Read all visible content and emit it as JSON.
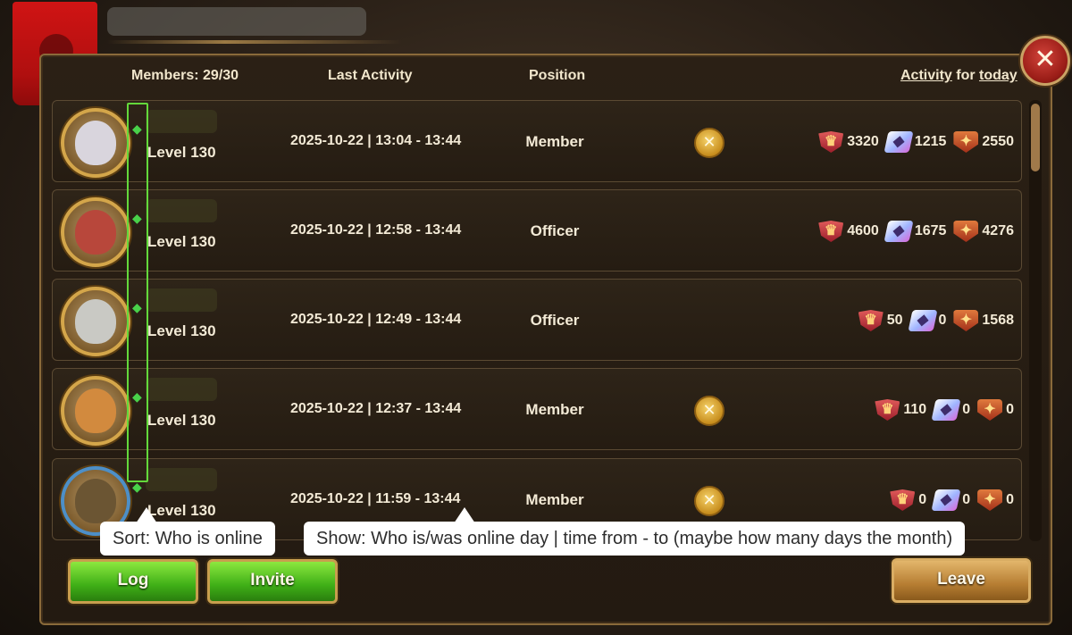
{
  "header": {
    "members_label": "Members:",
    "members_count": "29/30",
    "last_activity_label": "Last Activity",
    "position_label": "Position",
    "activity_word": "Activity",
    "for_word": "for",
    "period": "today"
  },
  "close_icon": "close-x-icon",
  "members": [
    {
      "level": "Level 130",
      "activity": "2025-10-22 | 13:04 - 13:44",
      "position": "Member",
      "kick": true,
      "stats": [
        "3320",
        "1215",
        "2550"
      ]
    },
    {
      "level": "Level 130",
      "activity": "2025-10-22 | 12:58 - 13:44",
      "position": "Officer",
      "kick": false,
      "stats": [
        "4600",
        "1675",
        "4276"
      ]
    },
    {
      "level": "Level 130",
      "activity": "2025-10-22 | 12:49 - 13:44",
      "position": "Officer",
      "kick": false,
      "stats": [
        "50",
        "0",
        "1568"
      ]
    },
    {
      "level": "Level 130",
      "activity": "2025-10-22 | 12:37 - 13:44",
      "position": "Member",
      "kick": true,
      "stats": [
        "110",
        "0",
        "0"
      ]
    },
    {
      "level": "Level 130",
      "activity": "2025-10-22 | 11:59 - 13:44",
      "position": "Member",
      "kick": true,
      "stats": [
        "0",
        "0",
        "0"
      ]
    }
  ],
  "callouts": {
    "sort": "Sort: Who is online",
    "show": "Show: Who is/was online day | time from - to  (maybe how many days the month)"
  },
  "buttons": {
    "log": "Log",
    "invite": "Invite",
    "leave": "Leave"
  },
  "colors": {
    "online_green": "#63d93b",
    "button_green": "#3faf17",
    "button_gold": "#b67d32",
    "close_red": "#9a1d17"
  }
}
